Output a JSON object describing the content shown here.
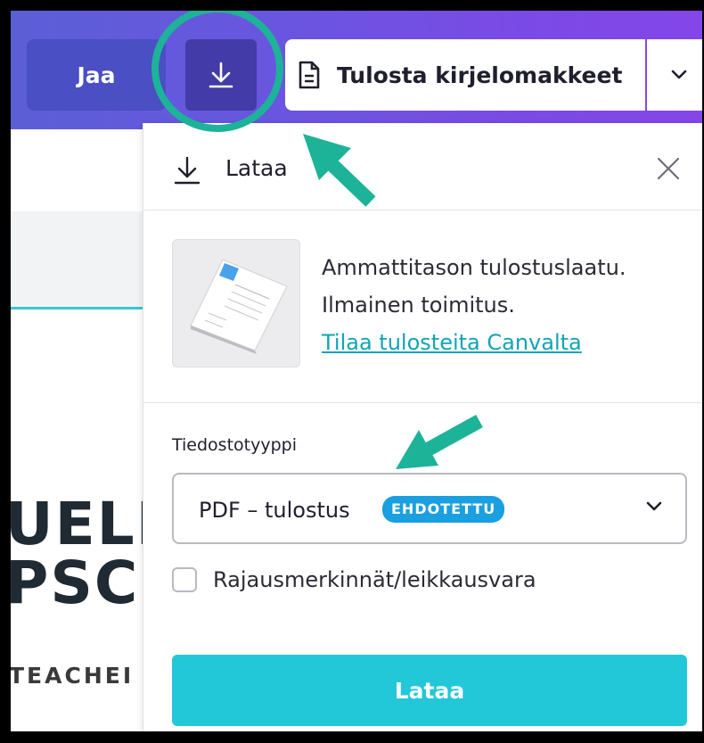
{
  "toolbar": {
    "share_label": "Jaa",
    "print_label": "Tulosta kirjelomakkeet"
  },
  "canvas": {
    "heading_line1": "UELI",
    "heading_line2": "PSC",
    "subtitle": "TEACHEI"
  },
  "panel": {
    "title": "Lataa",
    "promo": {
      "line1": "Ammattitason tulostuslaatu.",
      "line2": "Ilmainen toimitus.",
      "link": "Tilaa tulosteita Canvalta"
    },
    "file_type_label": "Tiedostotyyppi",
    "file_type_value": "PDF – tulostus",
    "file_type_badge": "EHDOTETTU",
    "checkbox_label": "Rajausmerkinnät/leikkausvara",
    "checkbox_checked": false,
    "download_button": "Lataa"
  },
  "colors": {
    "accent_teal": "#22c8d8",
    "annotation_green": "#1db398",
    "badge_blue": "#1a9fe0",
    "link_teal": "#10a4b8"
  },
  "icons": {
    "download": "download-icon",
    "document": "document-icon",
    "chevron": "chevron-down-icon",
    "close": "close-icon"
  }
}
